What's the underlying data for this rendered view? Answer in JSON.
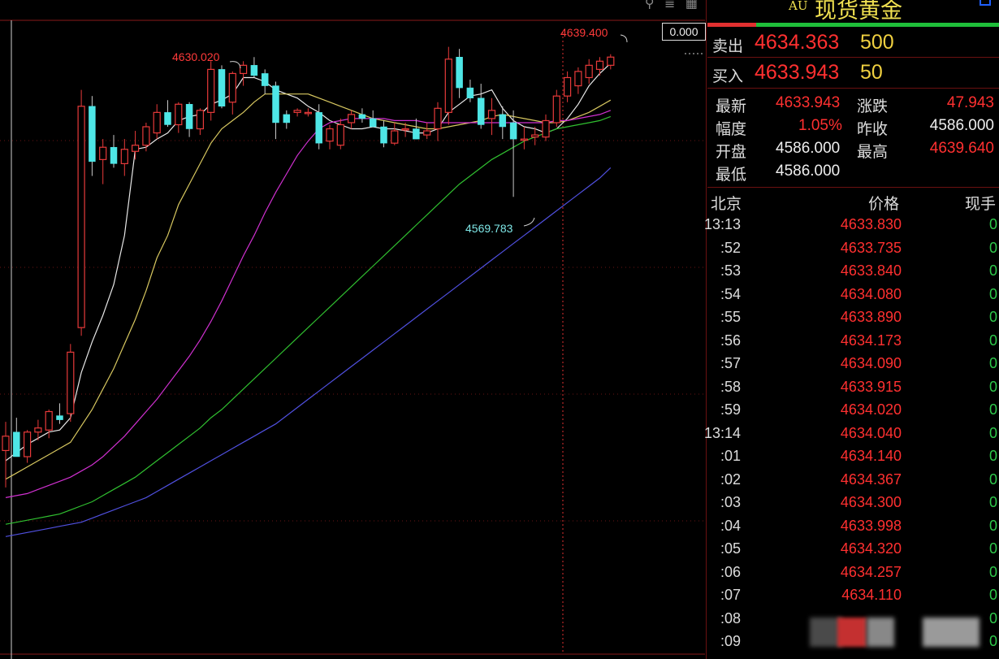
{
  "toolbar": {
    "icons": [
      "zoom-icon",
      "layout-icon",
      "grid-icon"
    ],
    "icon_glyphs": "⚲ ≣ ▦"
  },
  "chart": {
    "scale_readout": "0.000",
    "annotations": {
      "high_left": "4630.020",
      "high_right": "4639.400",
      "low_mid": "4569.783"
    },
    "colors": {
      "up": "#e83a3a",
      "down": "#4ee6e6",
      "ma5": "#e8e8e8",
      "ma10": "#d8c860",
      "ma20": "#d030d0",
      "ma40": "#30c030",
      "ma60": "#5050e0",
      "annotation_red": "#ff3a3a",
      "annotation_cyan": "#7ee6e6"
    }
  },
  "chart_data": {
    "type": "candlestick",
    "title": "",
    "y_range": [
      4420,
      4650
    ],
    "candles": [
      {
        "o": 4446,
        "h": 4460,
        "l": 4428,
        "c": 4453
      },
      {
        "o": 4455,
        "h": 4462,
        "l": 4443,
        "c": 4443
      },
      {
        "o": 4443,
        "h": 4456,
        "l": 4440,
        "c": 4455
      },
      {
        "o": 4455,
        "h": 4461,
        "l": 4451,
        "c": 4457
      },
      {
        "o": 4456,
        "h": 4466,
        "l": 4452,
        "c": 4465
      },
      {
        "o": 4463,
        "h": 4469,
        "l": 4459,
        "c": 4461
      },
      {
        "o": 4464,
        "h": 4498,
        "l": 4460,
        "c": 4494
      },
      {
        "o": 4506,
        "h": 4622,
        "l": 4502,
        "c": 4614
      },
      {
        "o": 4614,
        "h": 4619,
        "l": 4580,
        "c": 4587
      },
      {
        "o": 4588,
        "h": 4598,
        "l": 4576,
        "c": 4594
      },
      {
        "o": 4594,
        "h": 4600,
        "l": 4584,
        "c": 4586
      },
      {
        "o": 4586,
        "h": 4598,
        "l": 4580,
        "c": 4593
      },
      {
        "o": 4592,
        "h": 4602,
        "l": 4588,
        "c": 4595
      },
      {
        "o": 4595,
        "h": 4606,
        "l": 4592,
        "c": 4604
      },
      {
        "o": 4601,
        "h": 4615,
        "l": 4598,
        "c": 4611
      },
      {
        "o": 4611,
        "h": 4617,
        "l": 4604,
        "c": 4605
      },
      {
        "o": 4605,
        "h": 4616,
        "l": 4601,
        "c": 4615
      },
      {
        "o": 4615,
        "h": 4616,
        "l": 4599,
        "c": 4603
      },
      {
        "o": 4603,
        "h": 4613,
        "l": 4600,
        "c": 4612
      },
      {
        "o": 4611,
        "h": 4636,
        "l": 4607,
        "c": 4632
      },
      {
        "o": 4632,
        "h": 4634,
        "l": 4613,
        "c": 4614
      },
      {
        "o": 4616,
        "h": 4631,
        "l": 4610,
        "c": 4630
      },
      {
        "o": 4630,
        "h": 4636,
        "l": 4624,
        "c": 4634
      },
      {
        "o": 4634,
        "h": 4638,
        "l": 4628,
        "c": 4629
      },
      {
        "o": 4630,
        "h": 4632,
        "l": 4620,
        "c": 4624
      },
      {
        "o": 4624,
        "h": 4626,
        "l": 4598,
        "c": 4606
      },
      {
        "o": 4610,
        "h": 4612,
        "l": 4603,
        "c": 4606
      },
      {
        "o": 4611,
        "h": 4613,
        "l": 4609,
        "c": 4612
      },
      {
        "o": 4611,
        "h": 4613,
        "l": 4609,
        "c": 4611
      },
      {
        "o": 4611,
        "h": 4615,
        "l": 4593,
        "c": 4596
      },
      {
        "o": 4597,
        "h": 4605,
        "l": 4593,
        "c": 4603
      },
      {
        "o": 4595,
        "h": 4608,
        "l": 4593,
        "c": 4605
      },
      {
        "o": 4606,
        "h": 4612,
        "l": 4603,
        "c": 4610
      },
      {
        "o": 4610,
        "h": 4613,
        "l": 4606,
        "c": 4608
      },
      {
        "o": 4608,
        "h": 4612,
        "l": 4604,
        "c": 4604
      },
      {
        "o": 4604,
        "h": 4607,
        "l": 4594,
        "c": 4596
      },
      {
        "o": 4596,
        "h": 4606,
        "l": 4595,
        "c": 4602
      },
      {
        "o": 4603,
        "h": 4606,
        "l": 4599,
        "c": 4603
      },
      {
        "o": 4603,
        "h": 4608,
        "l": 4598,
        "c": 4598
      },
      {
        "o": 4600,
        "h": 4606,
        "l": 4598,
        "c": 4602
      },
      {
        "o": 4603,
        "h": 4616,
        "l": 4597,
        "c": 4613
      },
      {
        "o": 4611,
        "h": 4643,
        "l": 4605,
        "c": 4637
      },
      {
        "o": 4638,
        "h": 4642,
        "l": 4618,
        "c": 4623
      },
      {
        "o": 4623,
        "h": 4627,
        "l": 4616,
        "c": 4618
      },
      {
        "o": 4618,
        "h": 4625,
        "l": 4603,
        "c": 4605
      },
      {
        "o": 4608,
        "h": 4618,
        "l": 4600,
        "c": 4612
      },
      {
        "o": 4610,
        "h": 4614,
        "l": 4598,
        "c": 4604
      },
      {
        "o": 4606,
        "h": 4612,
        "l": 4569.783,
        "c": 4598
      },
      {
        "o": 4598,
        "h": 4604,
        "l": 4593,
        "c": 4598
      },
      {
        "o": 4599,
        "h": 4604,
        "l": 4595,
        "c": 4600
      },
      {
        "o": 4599,
        "h": 4610,
        "l": 4597,
        "c": 4607
      },
      {
        "o": 4606,
        "h": 4622,
        "l": 4604,
        "c": 4619
      },
      {
        "o": 4619,
        "h": 4631,
        "l": 4616,
        "c": 4628
      },
      {
        "o": 4624,
        "h": 4633,
        "l": 4620,
        "c": 4631
      },
      {
        "o": 4628,
        "h": 4637,
        "l": 4625,
        "c": 4634
      },
      {
        "o": 4632,
        "h": 4638,
        "l": 4629,
        "c": 4636
      },
      {
        "o": 4634,
        "h": 4639.4,
        "l": 4632,
        "c": 4638
      }
    ],
    "moving_averages": [
      {
        "name": "MA5",
        "color": "#e8e8e8",
        "values": [
          4441,
          4445,
          4449,
          4452,
          4455,
          4456,
          4462,
          4484,
          4499,
          4512,
          4527,
          4551,
          4593,
          4594,
          4598,
          4601,
          4607,
          4609,
          4610,
          4615,
          4617,
          4620,
          4628,
          4628,
          4626,
          4622,
          4620,
          4618,
          4614,
          4611,
          4607,
          4605,
          4603,
          4603,
          4604,
          4603,
          4603,
          4602,
          4601,
          4601,
          4603,
          4611,
          4615,
          4619,
          4620,
          4622,
          4613,
          4607,
          4604,
          4603,
          4601,
          4603,
          4608,
          4615,
          4624,
          4630,
          4635
        ]
      },
      {
        "name": "MA10",
        "color": "#d8c860",
        "values": [
          4432,
          4435,
          4438,
          4441,
          4444,
          4447,
          4450,
          4458,
          4466,
          4476,
          4486,
          4498,
          4510,
          4524,
          4540,
          4551,
          4566,
          4576,
          4586,
          4596,
          4603,
          4607,
          4611,
          4616,
          4620,
          4620,
          4620,
          4620,
          4620,
          4618,
          4616,
          4614,
          4612,
          4610,
          4608,
          4607,
          4606,
          4605,
          4604,
          4603,
          4603,
          4604,
          4605,
          4606,
          4607,
          4609,
          4610,
          4609,
          4608,
          4607,
          4606,
          4606,
          4607,
          4609,
          4611,
          4614,
          4617
        ]
      },
      {
        "name": "MA20",
        "color": "#d030d0",
        "values": [
          4423,
          4424,
          4425,
          4427,
          4429,
          4431,
          4433,
          4436,
          4439,
          4443,
          4448,
          4453,
          4459,
          4465,
          4471,
          4478,
          4485,
          4492,
          4500,
          4509,
          4519,
          4530,
          4541,
          4551,
          4562,
          4572,
          4581,
          4590,
          4597,
          4603,
          4606,
          4607,
          4608,
          4608,
          4608,
          4608,
          4607,
          4607,
          4607,
          4606,
          4606,
          4606,
          4606,
          4606,
          4606,
          4606,
          4606,
          4606,
          4606,
          4606,
          4606,
          4607,
          4607,
          4608,
          4609,
          4610,
          4612
        ]
      },
      {
        "name": "MA40",
        "color": "#30c030",
        "values": [
          4410,
          4411,
          4412,
          4413,
          4414,
          4415,
          4417,
          4419,
          4421,
          4424,
          4427,
          4430,
          4433,
          4437,
          4441,
          4445,
          4449,
          4453,
          4457,
          4462,
          4466,
          4471,
          4476,
          4481,
          4486,
          4491,
          4496,
          4501,
          4506,
          4511,
          4516,
          4521,
          4526,
          4531,
          4536,
          4541,
          4546,
          4551,
          4556,
          4561,
          4566,
          4571,
          4576,
          4580,
          4584,
          4588,
          4591,
          4594,
          4597,
          4599,
          4601,
          4603,
          4604,
          4605,
          4606,
          4607,
          4609
        ]
      },
      {
        "name": "MA60",
        "color": "#5050e0",
        "values": [
          4404,
          4405,
          4406,
          4407,
          4408,
          4409,
          4410,
          4411,
          4413,
          4415,
          4417,
          4419,
          4421,
          4423,
          4426,
          4429,
          4432,
          4435,
          4438,
          4441,
          4444,
          4447,
          4450,
          4453,
          4456,
          4459,
          4463,
          4467,
          4471,
          4475,
          4479,
          4483,
          4487,
          4491,
          4495,
          4499,
          4503,
          4507,
          4511,
          4515,
          4519,
          4523,
          4527,
          4531,
          4535,
          4539,
          4543,
          4547,
          4551,
          4555,
          4559,
          4563,
          4567,
          4571,
          4575,
          4579,
          4584
        ]
      }
    ]
  },
  "panel": {
    "code": "AU",
    "name": "现货黄金",
    "sell": {
      "label": "卖出",
      "price": "4634.363",
      "volume": "500"
    },
    "buy": {
      "label": "买入",
      "price": "4633.943",
      "volume": "50"
    },
    "stats": {
      "latest_label": "最新",
      "latest": "4633.943",
      "change_label": "涨跌",
      "change": "47.943",
      "range_label": "幅度",
      "range": "1.05%",
      "prev_close_label": "昨收",
      "prev_close": "4586.000",
      "open_label": "开盘",
      "open": "4586.000",
      "high_label": "最高",
      "high": "4639.640",
      "low_label": "最低",
      "low": "4586.000"
    },
    "ticks_header": {
      "time": "北京",
      "price": "价格",
      "volume": "现手"
    },
    "ticks": [
      {
        "time": "13:13",
        "price": "4633.830",
        "vol": "0"
      },
      {
        "time": ":52",
        "price": "4633.735",
        "vol": "0"
      },
      {
        "time": ":53",
        "price": "4633.840",
        "vol": "0"
      },
      {
        "time": ":54",
        "price": "4634.080",
        "vol": "0"
      },
      {
        "time": ":55",
        "price": "4633.890",
        "vol": "0"
      },
      {
        "time": ":56",
        "price": "4634.173",
        "vol": "0"
      },
      {
        "time": ":57",
        "price": "4634.090",
        "vol": "0"
      },
      {
        "time": ":58",
        "price": "4633.915",
        "vol": "0"
      },
      {
        "time": ":59",
        "price": "4634.020",
        "vol": "0"
      },
      {
        "time": "13:14",
        "price": "4634.040",
        "vol": "0"
      },
      {
        "time": ":01",
        "price": "4634.140",
        "vol": "0"
      },
      {
        "time": ":02",
        "price": "4634.367",
        "vol": "0"
      },
      {
        "time": ":03",
        "price": "4634.300",
        "vol": "0"
      },
      {
        "time": ":04",
        "price": "4633.998",
        "vol": "0"
      },
      {
        "time": ":05",
        "price": "4634.320",
        "vol": "0"
      },
      {
        "time": ":06",
        "price": "4634.257",
        "vol": "0"
      },
      {
        "time": ":07",
        "price": "4634.110",
        "vol": "0"
      },
      {
        "time": ":08",
        "price": "",
        "vol": "0"
      },
      {
        "time": ":09",
        "price": "",
        "vol": "0"
      }
    ]
  }
}
